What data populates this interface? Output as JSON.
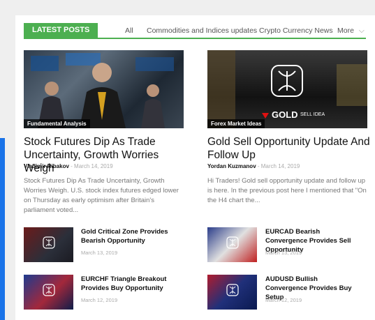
{
  "tabs": {
    "latest": "LATEST POSTS",
    "all": "All",
    "commodities": "Commodities and Indices updates",
    "crypto": "Crypto Currency News",
    "more": "More"
  },
  "featured": [
    {
      "category": "Fundamental Analysis",
      "title": "Stock Futures Dip As Trade Uncertainty, Growth Worries Weigh",
      "author": "Vladimir Ribakov",
      "date": "March 14, 2019",
      "excerpt": "Stock Futures Dip As Trade Uncertainty, Growth Worries Weigh. U.S. stock index futures edged lower on Thursday as early optimism after Britain's parliament voted..."
    },
    {
      "category": "Forex Market Ideas",
      "title": "Gold Sell Opportunity Update And Follow Up",
      "author": "Yordan Kuzmanov",
      "date": "March 14, 2019",
      "excerpt": "Hi Traders! Gold sell opportunity update and follow up is here. In the previous post here I mentioned that \"On the H4 chart the...",
      "image_text": "GOLD",
      "image_subtext": "SELL IDEA"
    }
  ],
  "small_posts": [
    {
      "title": "Gold Critical Zone Provides Bearish Opportunity",
      "date": "March 13, 2019"
    },
    {
      "title": "EURCAD Bearish Convergence Provides Sell Opportunity",
      "date": "March 13, 2019"
    },
    {
      "title": "EURCHF Triangle Breakout Provides Buy Opportunity",
      "date": "March 12, 2019"
    },
    {
      "title": "AUDUSD Bullish Convergence Provides Buy Setup",
      "date": "March 12, 2019"
    }
  ],
  "colors": {
    "accent_green": "#4caf50",
    "accent_blue": "#1a73e8"
  }
}
